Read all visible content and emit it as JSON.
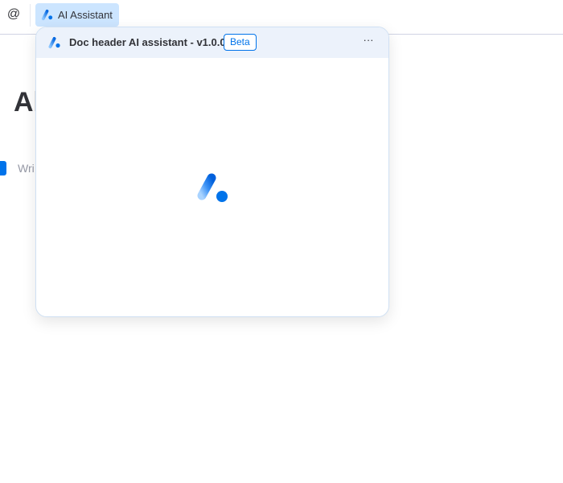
{
  "toolbar": {
    "mention_icon": "at-sign-icon",
    "ai_button_label": "AI Assistant",
    "ai_button_icon": "ai-assistant-logo-icon"
  },
  "document": {
    "title_visible": "Al",
    "write_placeholder_visible": "Wri"
  },
  "ai_panel": {
    "title": "Doc header AI assistant - v1.0.0",
    "badge": "Beta",
    "more_icon": "more-horizontal-icon",
    "more_glyph": "···",
    "loading_icon": "ai-assistant-logo-loading-icon"
  },
  "colors": {
    "accent": "#0073ea",
    "ai_button_bg": "#cce5ff",
    "panel_header_bg": "#ecf2fb",
    "logo_gradient_start": "#6fb7ff",
    "logo_gradient_end": "#0066e0"
  }
}
